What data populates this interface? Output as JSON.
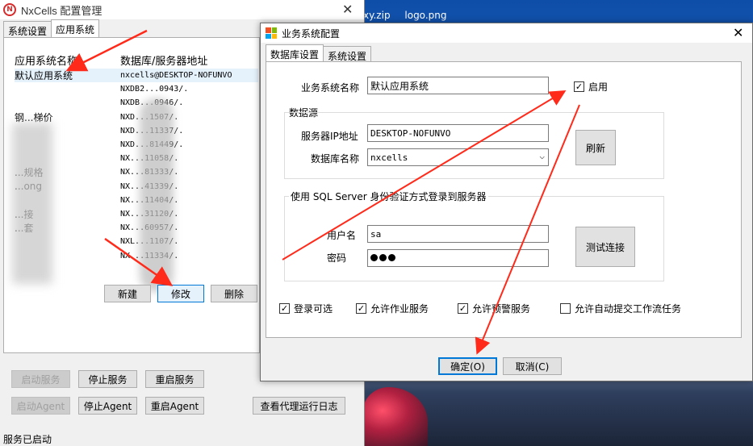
{
  "desktop": {
    "icons": [
      "xy.zip",
      "logo.png"
    ]
  },
  "main_window": {
    "title": "NxCells 配置管理",
    "app_icon_letter": "N",
    "tabs": [
      "系统设置",
      "应用系统"
    ],
    "list": {
      "columns": [
        "应用系统名称",
        "数据库/服务器地址"
      ],
      "rows": [
        {
          "name": "默认应用系统",
          "addr": "nxcells@DESKTOP-NOFUNVO"
        },
        {
          "name": "",
          "addr": "NXDB2...0943/."
        },
        {
          "name": "",
          "addr": "NXDB...0946/."
        },
        {
          "name": "钢...梯价",
          "addr": "NXD...1507/."
        },
        {
          "name": "",
          "addr": "NXD...11337/."
        },
        {
          "name": "",
          "addr": "NXD...81449/."
        },
        {
          "name": "",
          "addr": "NX...11058/."
        },
        {
          "name": "...规格",
          "addr": "NX...81333/."
        },
        {
          "name": "...ong",
          "addr": "NX...41339/."
        },
        {
          "name": "",
          "addr": "NX...11404/."
        },
        {
          "name": "...接",
          "addr": "NX...31120/."
        },
        {
          "name": "...套",
          "addr": "NX...60957/."
        },
        {
          "name": "",
          "addr": "NXL...1107/."
        },
        {
          "name": "",
          "addr": "NX...11334/."
        }
      ]
    },
    "list_buttons": {
      "new": "新建",
      "edit": "修改",
      "delete": "删除"
    },
    "service_buttons": {
      "start_service": "启动服务",
      "stop_service": "停止服务",
      "restart_service": "重启服务",
      "start_agent": "启动Agent",
      "stop_agent": "停止Agent",
      "restart_agent": "重启Agent",
      "view_agent_log": "查看代理运行日志"
    },
    "status": "服务已启动"
  },
  "dialog": {
    "title": "业务系统配置",
    "tabs": [
      "数据库设置",
      "系统设置"
    ],
    "system_name_label": "业务系统名称",
    "system_name_value": "默认应用系统",
    "enabled_label": "启用",
    "datasource_label": "数据源",
    "server_ip_label": "服务器IP地址",
    "server_ip_value": "DESKTOP-NOFUNVO",
    "db_name_label": "数据库名称",
    "db_name_value": "nxcells",
    "refresh_button": "刷新",
    "auth_group_label": "使用 SQL Server 身份验证方式登录到服务器",
    "username_label": "用户名",
    "username_value": "sa",
    "password_label": "密码",
    "password_dots": 3,
    "test_connection_button": "测试连接",
    "options": [
      {
        "label": "登录可选",
        "checked": true
      },
      {
        "label": "允许作业服务",
        "checked": true
      },
      {
        "label": "允许预警服务",
        "checked": true
      },
      {
        "label": "允许自动提交工作流任务",
        "checked": false
      }
    ],
    "ok_button": "确定(O)",
    "cancel_button": "取消(C)"
  },
  "colors": {
    "arrow": "#ff2a1a",
    "focus": "#0078d7",
    "app_red": "#d82a2a"
  }
}
